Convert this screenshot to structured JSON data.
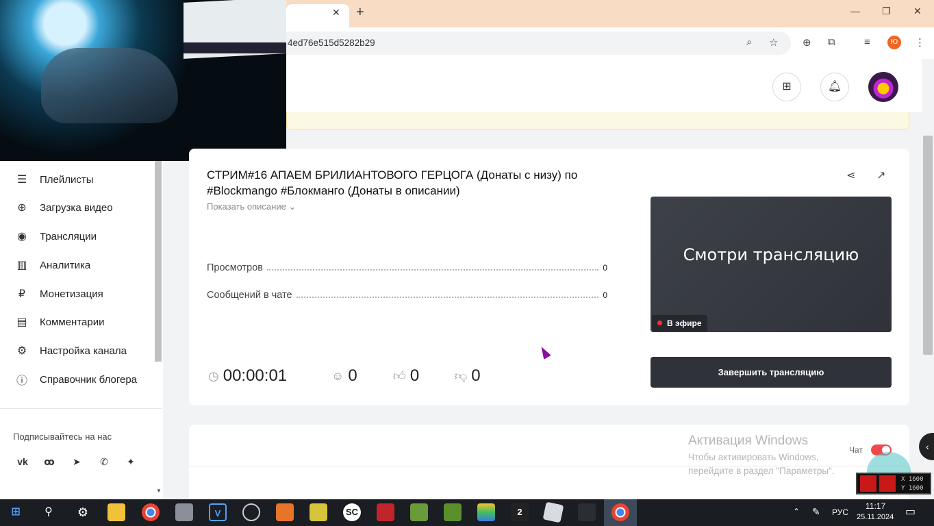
{
  "browser": {
    "tab_close": "✕",
    "new_tab": "+",
    "url": "4ed76e515d5282b29",
    "profile_initial": "Ю",
    "window": {
      "minimize": "—",
      "restore": "❐",
      "close": "✕"
    }
  },
  "sidebar": {
    "items": [
      {
        "label": "Плейлисты",
        "icon": "list-icon",
        "glyph": "☰"
      },
      {
        "label": "Загрузка видео",
        "icon": "upload-icon",
        "glyph": "⊕"
      },
      {
        "label": "Трансляции",
        "icon": "broadcast-icon",
        "glyph": "◉"
      },
      {
        "label": "Аналитика",
        "icon": "analytics-icon",
        "glyph": "▥"
      },
      {
        "label": "Монетизация",
        "icon": "ruble-icon",
        "glyph": "₽"
      },
      {
        "label": "Комментарии",
        "icon": "comment-icon",
        "glyph": "▤"
      },
      {
        "label": "Настройка канала",
        "icon": "gear-icon",
        "glyph": "⚙"
      },
      {
        "label": "Справочник блогера",
        "icon": "info-icon",
        "glyph": "ⓘ"
      }
    ],
    "follow_label": "Подписывайтесь на нас",
    "socials": [
      {
        "name": "vk-icon",
        "glyph": "vk"
      },
      {
        "name": "odnoklassniki-icon",
        "glyph": "ꝏ"
      },
      {
        "name": "telegram-icon",
        "glyph": "➤"
      },
      {
        "name": "viber-icon",
        "glyph": "✆"
      },
      {
        "name": "zen-icon",
        "glyph": "✦"
      }
    ]
  },
  "stream": {
    "title": "СТРИМ#16 АПАЕМ БРИЛИАНТОВОГО ГЕРЦОГА (Донаты с низу) по #Blockmango #Блокманго (Донаты в описании)",
    "show_description": "Показать описание ⌄",
    "stats": [
      {
        "label": "Просмотров",
        "value": "0"
      },
      {
        "label": "Сообщений в чате",
        "value": "0"
      }
    ],
    "duration": "00:00:01",
    "viewers": "0",
    "likes": "0",
    "dislikes": "0",
    "preview_text": "Смотри трансляцию",
    "live_badge": "В эфире",
    "end_button": "Завершить трансляцию"
  },
  "chat": {
    "label": "Чат",
    "enabled": true
  },
  "watermark": {
    "title": "Активация Windows",
    "subtitle": "Чтобы активировать Windows, перейдите в раздел \"Параметры\"."
  },
  "overlay": {
    "x": "X 1600",
    "y": "Y 1600"
  },
  "taskbar": {
    "lang": "РУС",
    "time": "11:17",
    "date": "25.11.2024"
  },
  "colors": {
    "accent": "#f0474b",
    "tab_strip": "#f9dcc4",
    "button_dark": "#2f3238"
  }
}
